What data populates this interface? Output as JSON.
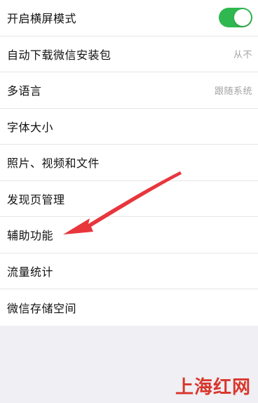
{
  "settings": {
    "rows": [
      {
        "label": "开启横屏模式",
        "toggle_on": true
      },
      {
        "label": "自动下载微信安装包",
        "value": "从不"
      },
      {
        "label": "多语言",
        "value": "跟随系统"
      },
      {
        "label": "字体大小"
      },
      {
        "label": "照片、视频和文件"
      },
      {
        "label": "发现页管理"
      },
      {
        "label": "辅助功能"
      },
      {
        "label": "流量统计"
      },
      {
        "label": "微信存储空间"
      }
    ]
  },
  "colors": {
    "toggle_on": "#2fb84f",
    "arrow": "#e8363d",
    "watermark": "#d9362c"
  },
  "watermark": {
    "text": "上海红网"
  }
}
